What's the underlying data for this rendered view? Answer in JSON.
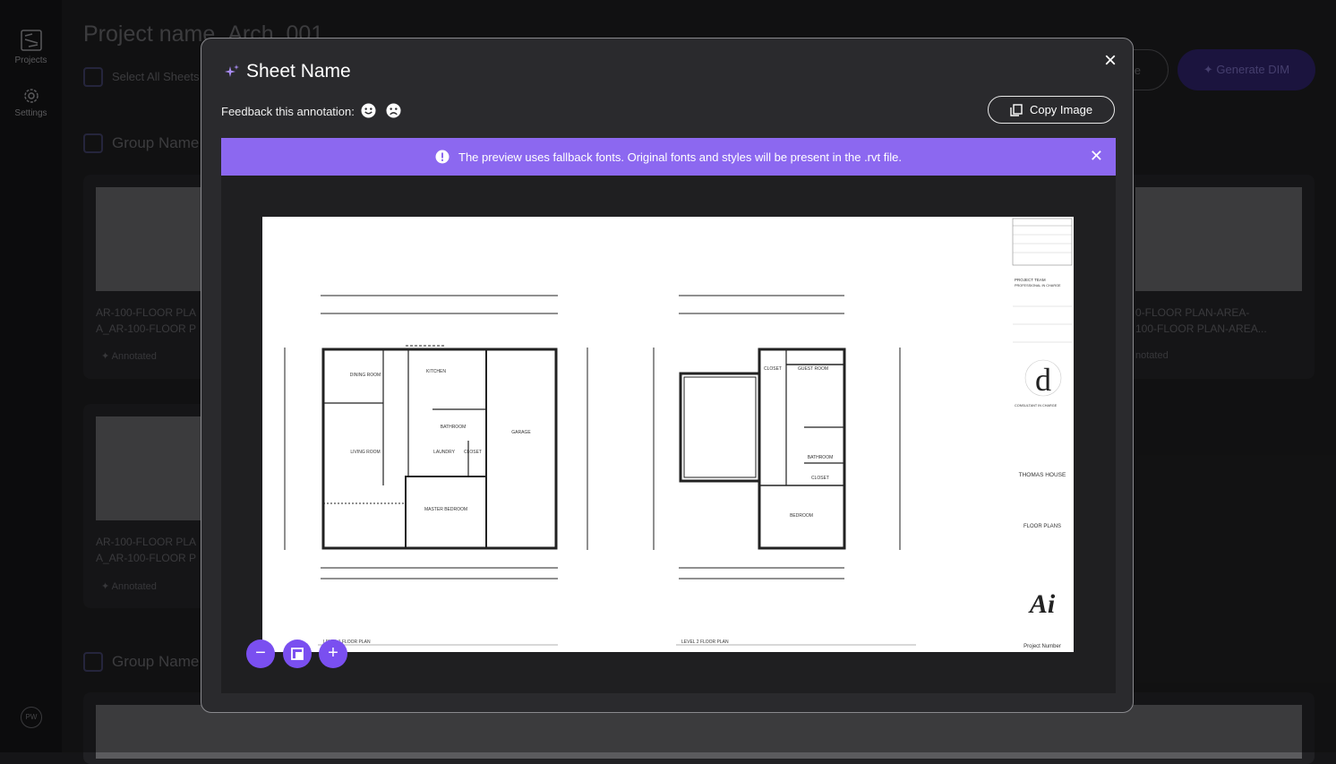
{
  "sidebar": {
    "items": [
      {
        "label": "Projects",
        "icon": "projects-icon"
      },
      {
        "label": "Settings",
        "icon": "gear-icon"
      }
    ],
    "avatar": "PW"
  },
  "background": {
    "project_title": "Project name_Arch_001",
    "select_all": "Select All Sheets",
    "group_name": "Group Name",
    "card_line1": "AR-100-FLOOR PLA",
    "card_line2": "A_AR-100-FLOOR P",
    "card_right_line1": "0-FLOOR PLAN-AREA-",
    "card_right_line2": "100-FLOOR PLAN-AREA...",
    "annotated": "Annotated",
    "right_annotated": "notated",
    "file_button": "ile",
    "generate_button": "Generate DIM"
  },
  "modal": {
    "title": "Sheet Name",
    "feedback_label": "Feedback this annotation:",
    "copy_button": "Copy Image",
    "banner_text": "The preview uses fallback fonts. Original fonts and styles will be present in the .rvt file.",
    "colors": {
      "accent": "#7a4ff0",
      "banner": "#8c68f0"
    }
  },
  "sheet": {
    "project_team": "PROJECT TEAM",
    "professional": "PROFESSIONAL IN CHARGE",
    "consultant": "CONSULTANT IN CHARGE",
    "project_name": "THOMAS HOUSE",
    "sheet_title": "FLOOR PLANS",
    "project_number": "Project Number",
    "logo": "Ai",
    "plan1_label": "LEVEL 1 FLOOR PLAN",
    "plan2_label": "LEVEL 2 FLOOR PLAN",
    "rooms1": [
      "DINING ROOM",
      "KITCHEN",
      "LIVING ROOM",
      "BATHROOM",
      "LAUNDRY",
      "CLOSET",
      "GARAGE",
      "MASTER BEDROOM"
    ],
    "rooms2": [
      "CLOSET",
      "GUEST ROOM",
      "BATHROOM",
      "CLOSET",
      "BEDROOM"
    ]
  }
}
